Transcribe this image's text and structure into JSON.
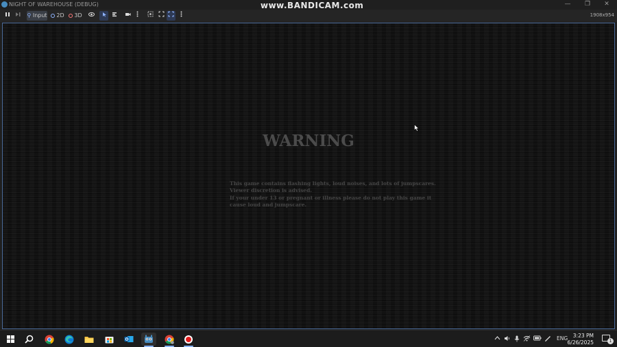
{
  "window": {
    "title": "NIGHT OF WAREHOUSE (DEBUG)",
    "watermark": "www.BANDICAM.com",
    "minimize": "—",
    "maximize": "❐",
    "close": "✕"
  },
  "toolbar": {
    "input_label": "Input",
    "mode_2d": "2D",
    "mode_3d": "3D",
    "resolution": "1908x954"
  },
  "game": {
    "warning_title": "WARNING",
    "warning_lines": [
      "This game contains flashing lights, loud noises, and lots of jumpscares.",
      "Viewer discretion is advised.",
      "If your under 13 or pregnant or illness please do not play this game it",
      "cause loud and jumpscare."
    ]
  },
  "taskbar": {
    "apps": [
      "windows-start-icon",
      "search-icon",
      "chrome-icon",
      "edge-icon",
      "file-explorer-icon",
      "store-icon",
      "outlook-icon",
      "godot-icon",
      "chrome-profile-icon",
      "bandicam-record-icon"
    ],
    "language": "ENG",
    "time": "3:23 PM",
    "date": "6/26/2025",
    "notification_count": "1"
  },
  "colors": {
    "accent": "#478cbf",
    "viewport_border": "#4a6a9a",
    "warning_text": "#4b4b4b"
  }
}
